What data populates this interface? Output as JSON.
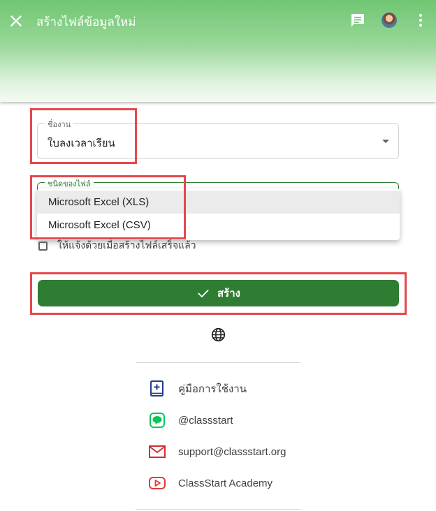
{
  "header": {
    "title": "สร้างไฟล์ข้อมูลใหม่",
    "icons": [
      "close-icon",
      "chat-icon",
      "avatar",
      "more-vert-icon"
    ]
  },
  "form": {
    "task_field": {
      "label": "ชื่องาน",
      "value": "ใบลงเวลาเรียน"
    },
    "file_type_field": {
      "label": "ชนิดของไฟล์",
      "options": [
        "Microsoft Excel (XLS)",
        "Microsoft Excel (CSV)"
      ]
    },
    "notify_label": "ให้แจ้งด้วยเมื่อสร้างไฟล์เสร็จแล้ว",
    "create_button": "สร้าง"
  },
  "footer": {
    "links": [
      {
        "label": "คู่มือการใช้งาน",
        "icon": "manual-book-icon"
      },
      {
        "label": "@classstart",
        "icon": "line-icon"
      },
      {
        "label": "support@classstart.org",
        "icon": "mail-icon"
      },
      {
        "label": "ClassStart Academy",
        "icon": "youtube-icon"
      }
    ]
  },
  "colors": {
    "accent": "#2e7d32",
    "highlight": "#e5474b",
    "line": "#06c755",
    "mail": "#d32f2f",
    "youtube": "#e53935",
    "manual": "#1f3f8f"
  }
}
